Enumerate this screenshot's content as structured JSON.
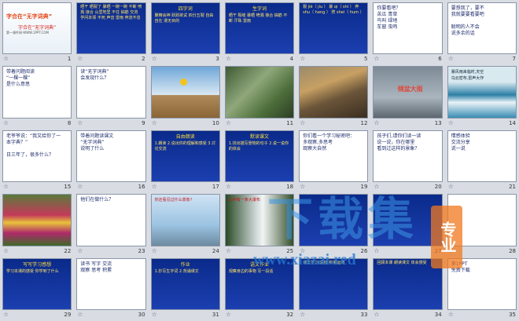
{
  "slides": [
    {
      "n": "1",
      "kind": "white",
      "title": "字合在“无字词典”",
      "sub": "第一课件网·WWW.1PPT.COM"
    },
    {
      "n": "2",
      "kind": "blue",
      "text": "晒干  晒裂了  暴晒  一碗一碗\n不断  喷溅  接合  山里地里\n不住  抽筋  交流  学问本领\n不死  声音  雷雨  奔流不息\n"
    },
    {
      "n": "3",
      "kind": "blue",
      "title": "四字词",
      "text": "聚精会神\n跃跃欲试\n四分五裂\n自由自在\n漫无目的"
    },
    {
      "n": "4",
      "kind": "blue",
      "title": "生字词",
      "text": "晒干  裂缝  暴晒\n喷溅  接合  抽筋\n不断  汗珠  雷雨"
    },
    {
      "n": "5",
      "kind": "blue",
      "text": "裂 jiè（ jiu ）\n暴 qi（ shi ）\n奔 shu（ hang ）\n劈 shei（ hum ）"
    },
    {
      "n": "6",
      "kind": "white",
      "text": "你要看吧？\n    苦瓜  青草\n    鸟叫  绿地\n    车窗  虫鸣"
    },
    {
      "n": "7",
      "kind": "white",
      "text": "要想我了，要不\n我就要要看要吧\n\n    聪明的人不会\n    说多余的话"
    },
    {
      "n": "8",
      "kind": "white",
      "text": "带着问题阅读\n“一棵一棵”\n是什么意思"
    },
    {
      "n": "9",
      "kind": "white",
      "text": "读“无字词典”\n会发现什么？"
    },
    {
      "n": "10",
      "kind": "sky",
      "text": ""
    },
    {
      "n": "11",
      "kind": "tree",
      "text": ""
    },
    {
      "n": "12",
      "kind": "tiger",
      "text": ""
    },
    {
      "n": "13",
      "kind": "rain",
      "label": "倾盆大雨"
    },
    {
      "n": "14",
      "kind": "sea",
      "text": "暴风雨来临时,天空\n乌云密布,雷声大作"
    },
    {
      "n": "15",
      "kind": "white",
      "text": "老爷爷说：“我又给你了一\n本字典？”\n\n 日三年了，很多什么？"
    },
    {
      "n": "16",
      "kind": "white",
      "text": "带着问题读课文\n“无字词典”\n说明了什么"
    },
    {
      "n": "17",
      "kind": "blue",
      "title": "自由朗读",
      "text": "1.朗读\n2.说出你的理解和感受\n3.讨论交流"
    },
    {
      "n": "18",
      "kind": "blue",
      "title": "默读课文",
      "text": "1.找出描写景物的句子\n2.说一说你的体会"
    },
    {
      "n": "19",
      "kind": "white",
      "text": "你们看一个学习秘密吧：\n多观察,多思考\n观察大自然"
    },
    {
      "n": "20",
      "kind": "white",
      "text": "孩子们,请你们读一读\n说一说，你在哪里\n看到过这样的景象？"
    },
    {
      "n": "21",
      "kind": "white",
      "text": "情感体验\n交流分享\n说一说"
    },
    {
      "n": "22",
      "kind": "flower",
      "label": ""
    },
    {
      "n": "23",
      "kind": "white",
      "text": "他们在做什么？"
    },
    {
      "n": "24",
      "kind": "city",
      "text": "你还看见过什么景象？"
    },
    {
      "n": "25",
      "kind": "fall",
      "text": "山中有一条大瀑布"
    },
    {
      "n": "26",
      "kind": "blue",
      "text": ""
    },
    {
      "n": "27",
      "kind": "blue",
      "text": ""
    },
    {
      "n": "28",
      "kind": "white",
      "text": ""
    },
    {
      "n": "29",
      "kind": "blue",
      "title": "写写学习感想",
      "text": "学习本课的感受\n你学到了什么"
    },
    {
      "n": "30",
      "kind": "white",
      "text": "读书  写字  交流\n观察  思考  积累"
    },
    {
      "n": "31",
      "kind": "blue",
      "title": "作业",
      "text": "1.抄写生字词\n2.背诵课文"
    },
    {
      "n": "32",
      "kind": "blue",
      "title": "语文作业",
      "text": "观察身边的事物\n写一段话"
    },
    {
      "n": "33",
      "kind": "blue",
      "text": "课文学习\n总结\n积累运用"
    },
    {
      "n": "34",
      "kind": "blue",
      "text": "回顾本课\n朗读课文\n体会感受"
    },
    {
      "n": "35",
      "kind": "white",
      "text": "第1PPT\n免费下载"
    }
  ],
  "watermark": {
    "main": "下载集",
    "badge": "专业",
    "url": "www.xiazai.red"
  },
  "colors": {
    "deep_blue": "#0a2a8a",
    "gold": "#ffde3a",
    "red": "#d8261f"
  }
}
